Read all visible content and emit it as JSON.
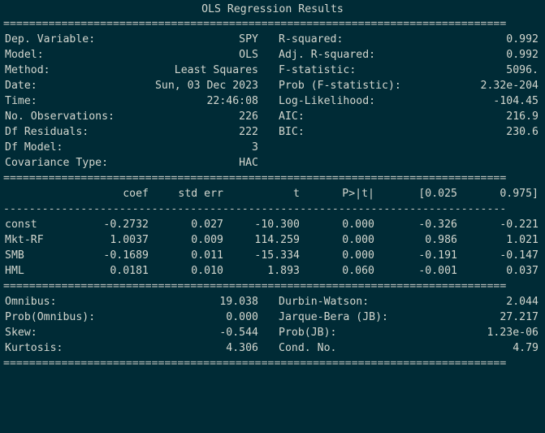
{
  "title": "OLS Regression Results",
  "rule_double": "==============================================================================",
  "rule_single": "------------------------------------------------------------------------------",
  "top": {
    "left": [
      {
        "label": "Dep. Variable:",
        "value": "SPY"
      },
      {
        "label": "Model:",
        "value": "OLS"
      },
      {
        "label": "Method:",
        "value": "Least Squares"
      },
      {
        "label": "Date:",
        "value": "Sun, 03 Dec 2023"
      },
      {
        "label": "Time:",
        "value": "22:46:08"
      },
      {
        "label": "No. Observations:",
        "value": "226"
      },
      {
        "label": "Df Residuals:",
        "value": "222"
      },
      {
        "label": "Df Model:",
        "value": "3"
      },
      {
        "label": "Covariance Type:",
        "value": "HAC"
      }
    ],
    "right": [
      {
        "label": "R-squared:",
        "value": "0.992"
      },
      {
        "label": "Adj. R-squared:",
        "value": "0.992"
      },
      {
        "label": "F-statistic:",
        "value": "5096."
      },
      {
        "label": "Prob (F-statistic):",
        "value": "2.32e-204"
      },
      {
        "label": "Log-Likelihood:",
        "value": "-104.45"
      },
      {
        "label": "AIC:",
        "value": "216.9"
      },
      {
        "label": "BIC:",
        "value": "230.6"
      }
    ]
  },
  "coef": {
    "headers": [
      "coef",
      "std err",
      "t",
      "P>|t|",
      "[0.025",
      "0.975]"
    ],
    "rows": [
      {
        "name": "const",
        "cells": [
          "-0.2732",
          "0.027",
          "-10.300",
          "0.000",
          "-0.326",
          "-0.221"
        ]
      },
      {
        "name": "Mkt-RF",
        "cells": [
          "1.0037",
          "0.009",
          "114.259",
          "0.000",
          "0.986",
          "1.021"
        ]
      },
      {
        "name": "SMB",
        "cells": [
          "-0.1689",
          "0.011",
          "-15.334",
          "0.000",
          "-0.191",
          "-0.147"
        ]
      },
      {
        "name": "HML",
        "cells": [
          "0.0181",
          "0.010",
          "1.893",
          "0.060",
          "-0.001",
          "0.037"
        ]
      }
    ]
  },
  "bottom": {
    "left": [
      {
        "label": "Omnibus:",
        "value": "19.038"
      },
      {
        "label": "Prob(Omnibus):",
        "value": "0.000"
      },
      {
        "label": "Skew:",
        "value": "-0.544"
      },
      {
        "label": "Kurtosis:",
        "value": "4.306"
      }
    ],
    "right": [
      {
        "label": "Durbin-Watson:",
        "value": "2.044"
      },
      {
        "label": "Jarque-Bera (JB):",
        "value": "27.217"
      },
      {
        "label": "Prob(JB):",
        "value": "1.23e-06"
      },
      {
        "label": "Cond. No.",
        "value": "4.79"
      }
    ]
  }
}
